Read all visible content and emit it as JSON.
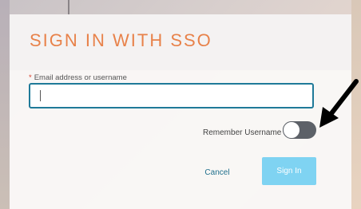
{
  "title": "SIGN IN WITH SSO",
  "email_field": {
    "required_marker": "*",
    "label": "Email address or username",
    "value": ""
  },
  "remember_username": {
    "label": "Remember Username",
    "enabled": false
  },
  "buttons": {
    "cancel": "Cancel",
    "sign_in": "Sign In"
  },
  "colors": {
    "title": "#e8824a",
    "input_border": "#1f7a99",
    "sign_in_bg": "#7fd3f2",
    "toggle_track": "#5d6168",
    "required": "#d9412b"
  }
}
